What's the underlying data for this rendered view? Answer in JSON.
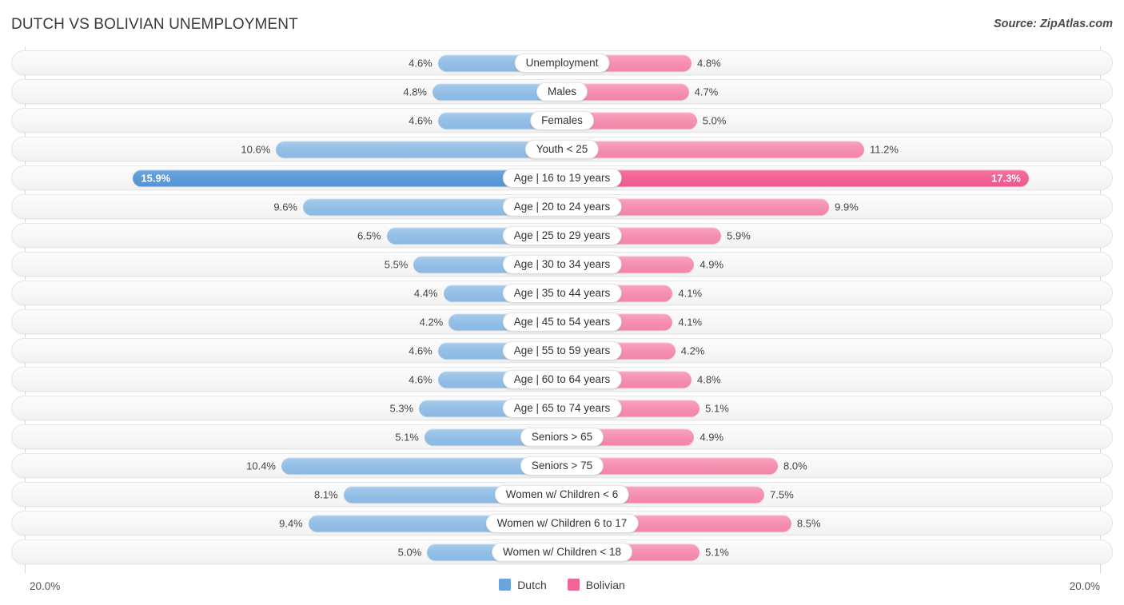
{
  "header": {
    "title": "DUTCH VS BOLIVIAN UNEMPLOYMENT",
    "source": "Source: ZipAtlas.com"
  },
  "axis": {
    "left_max_label": "20.0%",
    "right_max_label": "20.0%",
    "max_value": 20.0
  },
  "legend": {
    "items": [
      {
        "label": "Dutch",
        "color": "#6ba3dd"
      },
      {
        "label": "Bolivian",
        "color": "#f2659a"
      }
    ]
  },
  "colors": {
    "dutch": "#94bfe6",
    "dutch_highlight": "#5d9bd8",
    "bolivian": "#f58fb0",
    "bolivian_highlight": "#f06396",
    "track": "#f7f7f7",
    "gridline": "#d8d8d8"
  },
  "chart_data": {
    "type": "bar",
    "title": "DUTCH VS BOLIVIAN UNEMPLOYMENT",
    "subtitle": "",
    "xlabel": "",
    "ylabel": "",
    "orientation": "horizontal",
    "layout": "diverging-bidirectional",
    "grid": true,
    "legend_position": "bottom-center",
    "xlim": [
      0,
      20.0
    ],
    "axis_max_label": "20.0%",
    "categories": [
      "Unemployment",
      "Males",
      "Females",
      "Youth < 25",
      "Age | 16 to 19 years",
      "Age | 20 to 24 years",
      "Age | 25 to 29 years",
      "Age | 30 to 34 years",
      "Age | 35 to 44 years",
      "Age | 45 to 54 years",
      "Age | 55 to 59 years",
      "Age | 60 to 64 years",
      "Age | 65 to 74 years",
      "Seniors > 65",
      "Seniors > 75",
      "Women w/ Children < 6",
      "Women w/ Children 6 to 17",
      "Women w/ Children < 18"
    ],
    "series": [
      {
        "name": "Dutch",
        "side": "left",
        "color": "#94bfe6",
        "values": [
          4.6,
          4.8,
          4.6,
          10.6,
          15.9,
          9.6,
          6.5,
          5.5,
          4.4,
          4.2,
          4.6,
          4.6,
          5.3,
          5.1,
          10.4,
          8.1,
          9.4,
          5.0
        ],
        "labels": [
          "4.6%",
          "4.8%",
          "4.6%",
          "10.6%",
          "15.9%",
          "9.6%",
          "6.5%",
          "5.5%",
          "4.4%",
          "4.2%",
          "4.6%",
          "4.6%",
          "5.3%",
          "5.1%",
          "10.4%",
          "8.1%",
          "9.4%",
          "5.0%"
        ]
      },
      {
        "name": "Bolivian",
        "side": "right",
        "color": "#f58fb0",
        "values": [
          4.8,
          4.7,
          5.0,
          11.2,
          17.3,
          9.9,
          5.9,
          4.9,
          4.1,
          4.1,
          4.2,
          4.8,
          5.1,
          4.9,
          8.0,
          7.5,
          8.5,
          5.1
        ],
        "labels": [
          "4.8%",
          "4.7%",
          "5.0%",
          "11.2%",
          "17.3%",
          "9.9%",
          "5.9%",
          "4.9%",
          "4.1%",
          "4.1%",
          "4.2%",
          "4.8%",
          "5.1%",
          "4.9%",
          "8.0%",
          "7.5%",
          "8.5%",
          "5.1%"
        ]
      }
    ],
    "highlighted_category": "Age | 16 to 19 years"
  },
  "rows": [
    {
      "label": "Unemployment",
      "left_value": 4.6,
      "left_label": "4.6%",
      "right_value": 4.8,
      "right_label": "4.8%",
      "highlight": false
    },
    {
      "label": "Males",
      "left_value": 4.8,
      "left_label": "4.8%",
      "right_value": 4.7,
      "right_label": "4.7%",
      "highlight": false
    },
    {
      "label": "Females",
      "left_value": 4.6,
      "left_label": "4.6%",
      "right_value": 5.0,
      "right_label": "5.0%",
      "highlight": false
    },
    {
      "label": "Youth < 25",
      "left_value": 10.6,
      "left_label": "10.6%",
      "right_value": 11.2,
      "right_label": "11.2%",
      "highlight": false
    },
    {
      "label": "Age | 16 to 19 years",
      "left_value": 15.9,
      "left_label": "15.9%",
      "right_value": 17.3,
      "right_label": "17.3%",
      "highlight": true
    },
    {
      "label": "Age | 20 to 24 years",
      "left_value": 9.6,
      "left_label": "9.6%",
      "right_value": 9.9,
      "right_label": "9.9%",
      "highlight": false
    },
    {
      "label": "Age | 25 to 29 years",
      "left_value": 6.5,
      "left_label": "6.5%",
      "right_value": 5.9,
      "right_label": "5.9%",
      "highlight": false
    },
    {
      "label": "Age | 30 to 34 years",
      "left_value": 5.5,
      "left_label": "5.5%",
      "right_value": 4.9,
      "right_label": "4.9%",
      "highlight": false
    },
    {
      "label": "Age | 35 to 44 years",
      "left_value": 4.4,
      "left_label": "4.4%",
      "right_value": 4.1,
      "right_label": "4.1%",
      "highlight": false
    },
    {
      "label": "Age | 45 to 54 years",
      "left_value": 4.2,
      "left_label": "4.2%",
      "right_value": 4.1,
      "right_label": "4.1%",
      "highlight": false
    },
    {
      "label": "Age | 55 to 59 years",
      "left_value": 4.6,
      "left_label": "4.6%",
      "right_value": 4.2,
      "right_label": "4.2%",
      "highlight": false
    },
    {
      "label": "Age | 60 to 64 years",
      "left_value": 4.6,
      "left_label": "4.6%",
      "right_value": 4.8,
      "right_label": "4.8%",
      "highlight": false
    },
    {
      "label": "Age | 65 to 74 years",
      "left_value": 5.3,
      "left_label": "5.3%",
      "right_value": 5.1,
      "right_label": "5.1%",
      "highlight": false
    },
    {
      "label": "Seniors > 65",
      "left_value": 5.1,
      "left_label": "5.1%",
      "right_value": 4.9,
      "right_label": "4.9%",
      "highlight": false
    },
    {
      "label": "Seniors > 75",
      "left_value": 10.4,
      "left_label": "10.4%",
      "right_value": 8.0,
      "right_label": "8.0%",
      "highlight": false
    },
    {
      "label": "Women w/ Children < 6",
      "left_value": 8.1,
      "left_label": "8.1%",
      "right_value": 7.5,
      "right_label": "7.5%",
      "highlight": false
    },
    {
      "label": "Women w/ Children 6 to 17",
      "left_value": 9.4,
      "left_label": "9.4%",
      "right_value": 8.5,
      "right_label": "8.5%",
      "highlight": false
    },
    {
      "label": "Women w/ Children < 18",
      "left_value": 5.0,
      "left_label": "5.0%",
      "right_value": 5.1,
      "right_label": "5.1%",
      "highlight": false
    }
  ]
}
